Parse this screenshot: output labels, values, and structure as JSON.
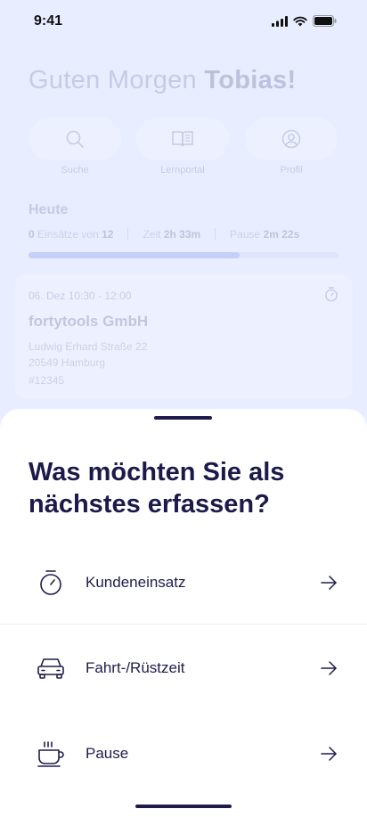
{
  "status_bar": {
    "time": "9:41"
  },
  "greeting": {
    "prefix": "Guten Morgen",
    "name": "Tobias!"
  },
  "quick_actions": [
    {
      "label": "Suche",
      "icon": "search-icon"
    },
    {
      "label": "Lernportal",
      "icon": "book-icon"
    },
    {
      "label": "Profil",
      "icon": "profile-icon"
    }
  ],
  "today": {
    "heading": "Heute",
    "assignments_done": "0",
    "assignments_text": "Einsätze von",
    "assignments_total": "12",
    "time_label": "Zeit",
    "time_value": "2h 33m",
    "pause_label": "Pause",
    "pause_value": "2m 22s",
    "progress_fraction": 0.68
  },
  "assignment_card": {
    "date": "06. Dez 10:30 - 12:00",
    "company": "fortytools GmbH",
    "street": "Ludwig Erhard Straße 22",
    "city": "20549 Hamburg",
    "id": "#12345"
  },
  "sheet": {
    "title": "Was möchten Sie als nächstes erfassen?",
    "options": [
      {
        "label": "Kundeneinsatz",
        "icon": "stopwatch-icon"
      },
      {
        "label": "Fahrt-/Rüstzeit",
        "icon": "car-icon"
      },
      {
        "label": "Pause",
        "icon": "coffee-cup-icon"
      }
    ]
  },
  "colors": {
    "accent": "#1f1b4f",
    "background": "#e8eeff",
    "sheet": "#ffffff"
  }
}
